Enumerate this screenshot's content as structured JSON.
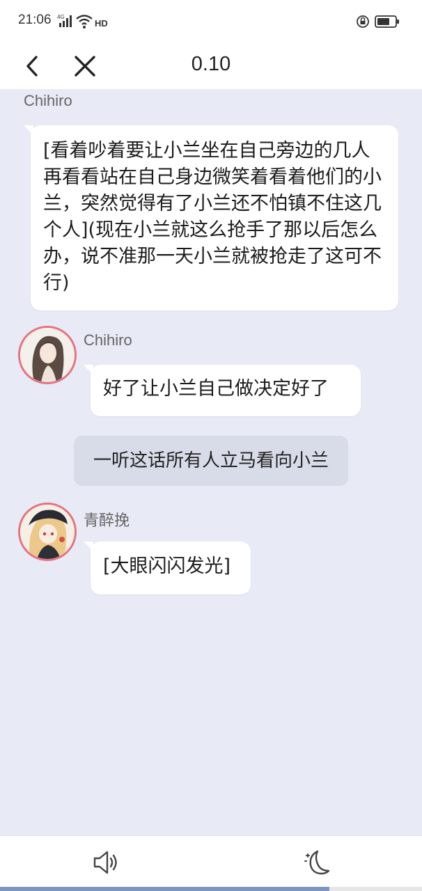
{
  "status_bar": {
    "time": "21:06",
    "network_label": "4G",
    "hd_label": "HD",
    "battery_level": 0.7
  },
  "header": {
    "title": "0.10"
  },
  "messages": [
    {
      "speaker": "Chihiro",
      "text": "[看着吵着要让小兰坐在自己旁边的几人再看看站在自己身边微笑着看着他们的小兰，突然觉得有了小兰还不怕镇不住这几个人](现在小兰就这么抢手了那以后怎么办，说不准那一天小兰就被抢走了这可不行)"
    },
    {
      "speaker": "Chihiro",
      "text": "好了让小兰自己做决定好了"
    },
    {
      "narration": "一听这话所有人立马看向小兰"
    },
    {
      "speaker": "青醉挽",
      "text": "[大眼闪闪发光]"
    }
  ],
  "bottom_bar": {
    "progress": 0.78
  },
  "colors": {
    "chat_background": "#e8eaf6",
    "avatar_border": "#e57380",
    "narration_background": "#d8dbe8",
    "progress_fill": "#7e95c2"
  },
  "icons": [
    "back-arrow-icon",
    "close-icon",
    "sound-icon",
    "night-mode-icon",
    "signal-icon",
    "wifi-icon",
    "lock-icon",
    "battery-icon"
  ]
}
